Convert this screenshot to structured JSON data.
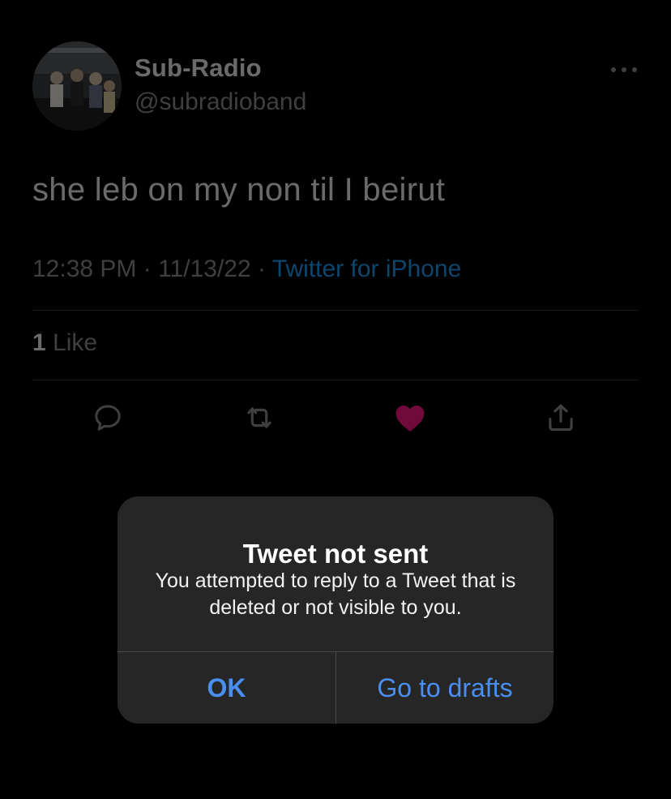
{
  "tweet": {
    "display_name": "Sub-Radio",
    "handle": "@subradioband",
    "text": "she leb on my non til I beirut",
    "time": "12:38 PM",
    "date": "11/13/22",
    "separator": "·",
    "source": "Twitter for iPhone",
    "like_count": "1",
    "like_label": "Like"
  },
  "actions": {
    "reply_icon": "speech-bubble",
    "retweet_icon": "retweet-arrows",
    "like_icon": "heart-filled",
    "share_icon": "share-upload",
    "liked_color": "#f91880"
  },
  "dialog": {
    "title": "Tweet not sent",
    "message": "You attempted to reply to a Tweet that is deleted or not visible to you.",
    "ok_label": "OK",
    "drafts_label": "Go to drafts",
    "button_color": "#4a8ff0"
  },
  "colors": {
    "background": "#000000",
    "link": "#1d9bf0",
    "muted_text": "#8a8d91"
  }
}
